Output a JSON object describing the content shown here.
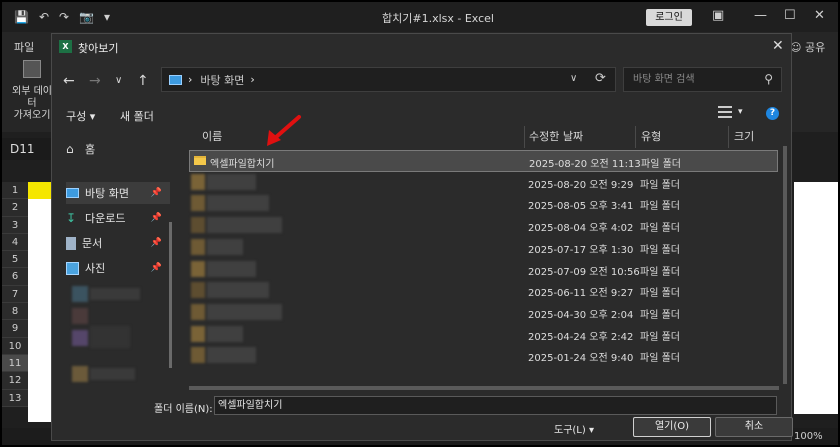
{
  "excel": {
    "title": "합치기#1.xlsx  -  Excel",
    "login_label": "로그인",
    "file_tab": "파일",
    "share_label": "공유",
    "external_data_label_1": "외부 데이터",
    "external_data_label_2": "가져오기",
    "name_box": "D11",
    "row_numbers": [
      "1",
      "2",
      "3",
      "4",
      "5",
      "6",
      "7",
      "8",
      "9",
      "10",
      "11",
      "12",
      "13"
    ],
    "zoom": "100%"
  },
  "dialog": {
    "title": "찾아보기",
    "address": {
      "location": "바탕 화면"
    },
    "search_placeholder": "바탕 화면 검색",
    "toolbar": {
      "organize": "구성",
      "new_folder": "새 폴더"
    },
    "sidebar": {
      "items": [
        {
          "label": "홈",
          "icon": "home-icon"
        },
        {
          "label": "바탕 화면",
          "icon": "desktop-icon",
          "pinned": true,
          "active": true
        },
        {
          "label": "다운로드",
          "icon": "download-icon",
          "pinned": true
        },
        {
          "label": "문서",
          "icon": "document-icon",
          "pinned": true
        },
        {
          "label": "사진",
          "icon": "pictures-icon",
          "pinned": true
        }
      ]
    },
    "columns": {
      "name": "이름",
      "modified": "수정한 날짜",
      "type": "유형",
      "size": "크기"
    },
    "files": [
      {
        "name": "엑셀파일합치기",
        "modified": "2025-08-20 오전 11:13",
        "type": "파일 폴더",
        "selected": true
      },
      {
        "name": "",
        "modified": "2025-08-20 오전 9:29",
        "type": "파일 폴더"
      },
      {
        "name": "",
        "modified": "2025-08-05 오후 3:41",
        "type": "파일 폴더"
      },
      {
        "name": "",
        "modified": "2025-08-04 오후 4:02",
        "type": "파일 폴더"
      },
      {
        "name": "",
        "modified": "2025-07-17 오후 1:30",
        "type": "파일 폴더"
      },
      {
        "name": "",
        "modified": "2025-07-09 오전 10:56",
        "type": "파일 폴더"
      },
      {
        "name": "",
        "modified": "2025-06-11 오전 9:27",
        "type": "파일 폴더"
      },
      {
        "name": "",
        "modified": "2025-04-30 오후 2:04",
        "type": "파일 폴더"
      },
      {
        "name": "",
        "modified": "2025-04-24 오후 2:42",
        "type": "파일 폴더"
      },
      {
        "name": "",
        "modified": "2025-01-24 오전 9:40",
        "type": "파일 폴더"
      }
    ],
    "folder_name_label": "폴더 이름(N):",
    "folder_name_value": "엑셀파일합치기",
    "tools_label": "도구(L)",
    "open_button": "열기(O)",
    "cancel_button": "취소",
    "accent_color": "#1e86e0"
  }
}
